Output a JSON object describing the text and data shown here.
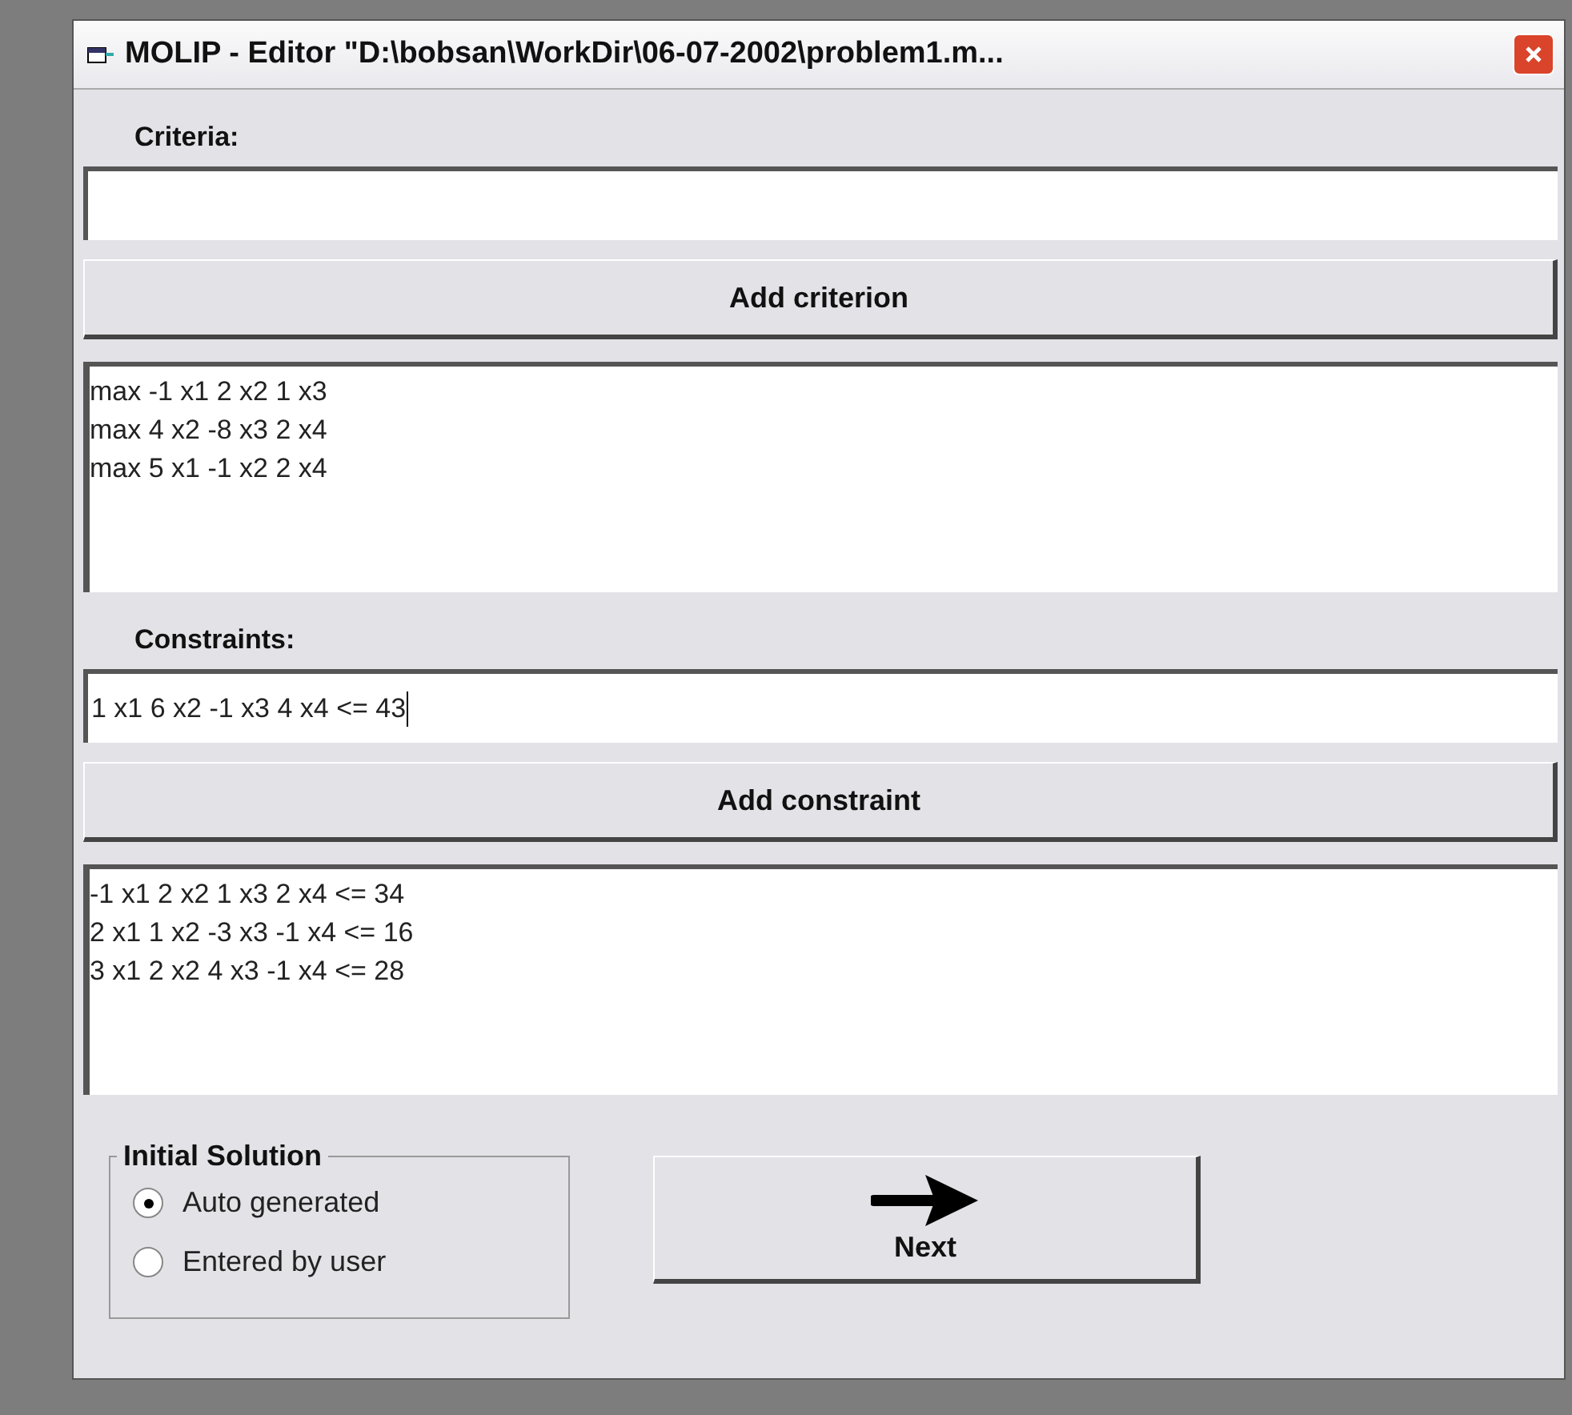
{
  "window": {
    "title": "MOLIP - Editor \"D:\\bobsan\\WorkDir\\06-07-2002\\problem1.m..."
  },
  "criteria": {
    "label": "Criteria:",
    "button": "Add criterion",
    "list": [
      "max -1 x1 2 x2 1 x3",
      "max 4 x2 -8 x3 2 x4",
      "max 5 x1 -1 x2 2 x4"
    ]
  },
  "constraints": {
    "label": "Constraints:",
    "value": "1 x1 6 x2 -1 x3 4 x4 <= 43",
    "button": "Add constraint",
    "list": [
      "-1 x1 2 x2 1 x3 2 x4 <= 34",
      "2 x1 1 x2 -3 x3 -1 x4 <= 16",
      "3 x1 2 x2 4 x3 -1 x4 <= 28"
    ]
  },
  "initial_solution": {
    "label": "Initial Solution",
    "options": [
      {
        "label": "Auto generated",
        "selected": true
      },
      {
        "label": "Entered by user",
        "selected": false
      }
    ]
  },
  "next_button": "Next"
}
